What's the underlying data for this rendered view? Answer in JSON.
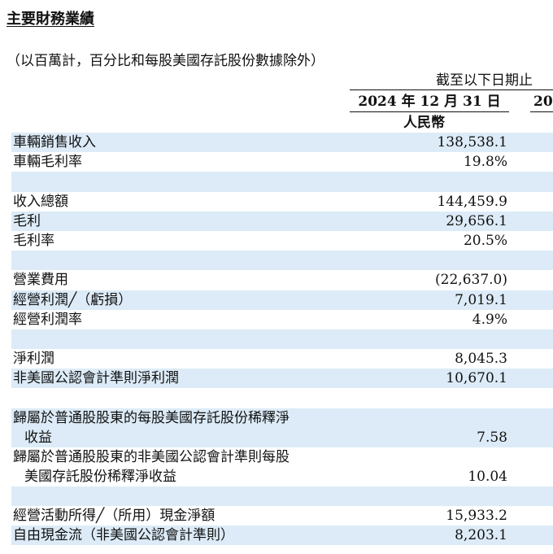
{
  "title": "主要財務業績",
  "subtitle": "（以百萬計，百分比和每股美國存託股份數據除外）",
  "period_header": "截至以下日期止",
  "columns": [
    "2024 年 12 月 31 日",
    "20"
  ],
  "currency": "人民幣",
  "rows": [
    {
      "label": "車輛銷售收入",
      "value": "138,538.1"
    },
    {
      "label": "車輛毛利率",
      "value": "19.8%"
    },
    {
      "label": "",
      "value": ""
    },
    {
      "label": "收入總額",
      "value": "144,459.9"
    },
    {
      "label": "毛利",
      "value": "29,656.1"
    },
    {
      "label": "毛利率",
      "value": "20.5%"
    },
    {
      "label": "",
      "value": ""
    },
    {
      "label": "營業費用",
      "value": "(22,637.0)"
    },
    {
      "label": "經營利潤╱（虧損）",
      "value": "7,019.1"
    },
    {
      "label": "經營利潤率",
      "value": "4.9%"
    },
    {
      "label": "",
      "value": ""
    },
    {
      "label": "淨利潤",
      "value": "8,045.3"
    },
    {
      "label": "非美國公認會計準則淨利潤",
      "value": "10,670.1"
    },
    {
      "label": "",
      "value": ""
    },
    {
      "label": "歸屬於普通股股東的每股美國存託股份稀釋淨",
      "label2": "收益",
      "value": "7.58"
    },
    {
      "label": "歸屬於普通股股東的非美國公認會計準則每股",
      "label2": "美國存託股份稀釋淨收益",
      "value": "10.04"
    },
    {
      "label": "",
      "value": ""
    },
    {
      "label": "經營活動所得╱（所用）現金淨額",
      "value": "15,933.2"
    },
    {
      "label": "自由現金流（非美國公認會計準則）",
      "value": "8,203.1"
    }
  ]
}
